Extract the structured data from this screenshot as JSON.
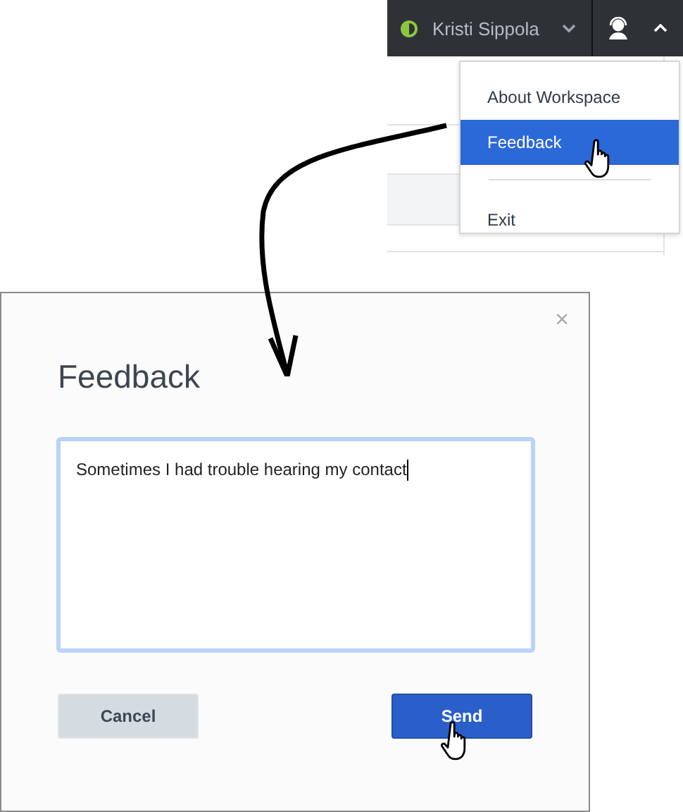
{
  "header": {
    "user_name": "Kristi Sippola"
  },
  "menu": {
    "items": [
      {
        "label": "About Workspace",
        "selected": false
      },
      {
        "label": "Feedback",
        "selected": true
      },
      {
        "label": "Exit",
        "selected": false
      }
    ]
  },
  "dialog": {
    "title": "Feedback",
    "close": "×",
    "message": "Sometimes I had trouble hearing my contact",
    "buttons": [
      {
        "label": "Cancel",
        "kind": "secondary"
      },
      {
        "label": "Send",
        "kind": "primary"
      }
    ]
  }
}
